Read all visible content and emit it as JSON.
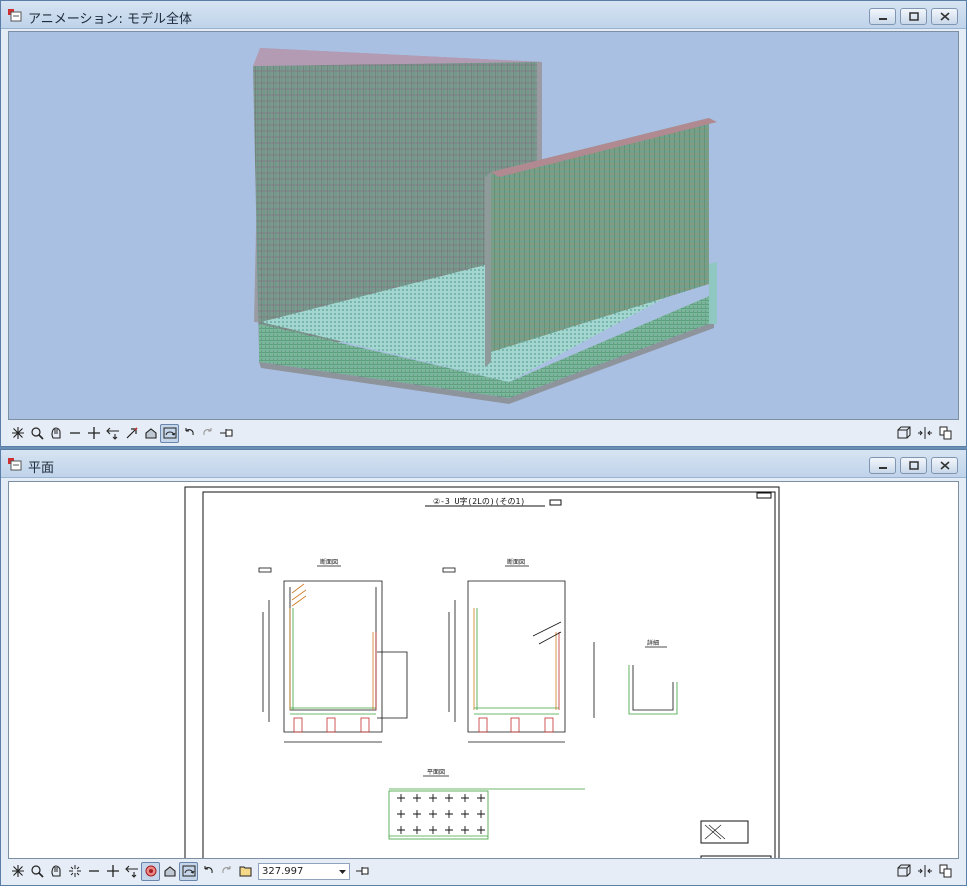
{
  "windows": {
    "top": {
      "title": "アニメーション: モデル全体"
    },
    "bottom": {
      "title": "平面"
    }
  },
  "drawing": {
    "sheet_title": "②-3 U字(2Lの)(その1)",
    "section_left_label": "断面図",
    "section_right_label": "断面図",
    "detail_label": "詳細",
    "plan_label": "平面図"
  },
  "toolbar_bottom": {
    "zoom_value": "327.997"
  },
  "icons": [
    "app-icon",
    "minimize-icon",
    "maximize-icon",
    "close-icon",
    "fit-icon",
    "zoom-icon",
    "pan-icon",
    "line-icon",
    "cross-icon",
    "arrow-icon",
    "rotate-icon",
    "shade-icon",
    "orbit-icon",
    "undo-icon",
    "redo-icon",
    "pin-icon",
    "view-3d-icon",
    "split-icon",
    "copy-icon",
    "folder-icon",
    "spark-icon",
    "target-icon"
  ]
}
